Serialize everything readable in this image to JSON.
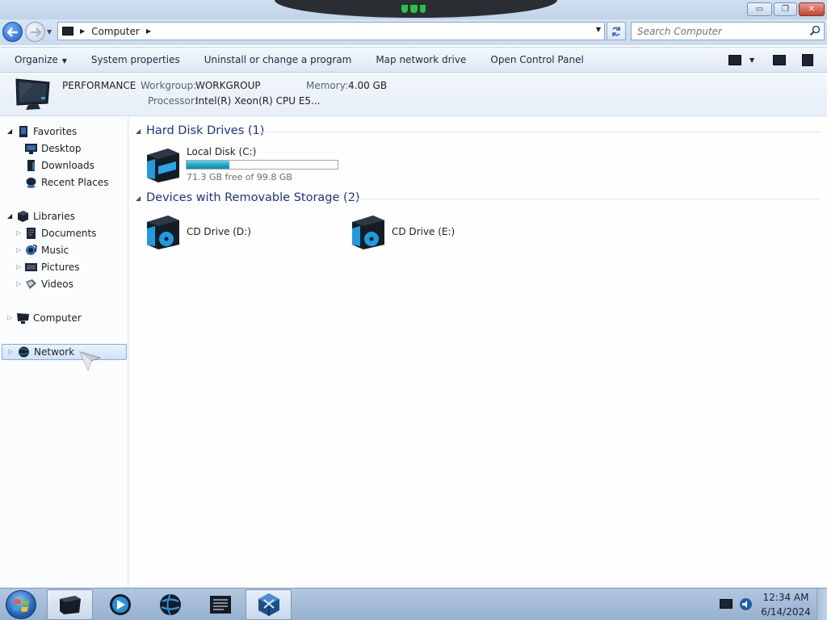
{
  "window": {
    "minimize_glyph": "▭",
    "maximize_glyph": "❐",
    "close_glyph": "✕"
  },
  "address": {
    "path": "Computer",
    "search_placeholder": "Search Computer"
  },
  "commands": {
    "organize": "Organize",
    "system_properties": "System properties",
    "uninstall": "Uninstall or change a program",
    "map_drive": "Map network drive",
    "control_panel": "Open Control Panel"
  },
  "info": {
    "computer_name": "PERFORMANCE",
    "workgroup_label": "Workgroup:",
    "workgroup_value": "WORKGROUP",
    "memory_label": "Memory:",
    "memory_value": "4.00 GB",
    "processor_label": "Processor:",
    "processor_value": "Intel(R) Xeon(R) CPU E5..."
  },
  "nav": {
    "favorites": "Favorites",
    "desktop": "Desktop",
    "downloads": "Downloads",
    "recent_places": "Recent Places",
    "libraries": "Libraries",
    "documents": "Documents",
    "music": "Music",
    "pictures": "Pictures",
    "videos": "Videos",
    "computer": "Computer",
    "network": "Network"
  },
  "groups": {
    "hdd": "Hard Disk Drives (1)",
    "removable": "Devices with Removable Storage (2)"
  },
  "drives": {
    "local_c": {
      "name": "Local Disk (C:)",
      "free_text": "71.3 GB free of 99.8 GB",
      "used_fraction": 0.286
    },
    "cd_d": {
      "name": "CD Drive (D:)"
    },
    "cd_e": {
      "name": "CD Drive (E:)"
    }
  },
  "taskbar": {
    "time": "12:34 AM",
    "date": "6/14/2024"
  },
  "colors": {
    "accent": "#1e3287",
    "selection": "#cfe3f8",
    "usage_bar": "#1aa5c6"
  }
}
